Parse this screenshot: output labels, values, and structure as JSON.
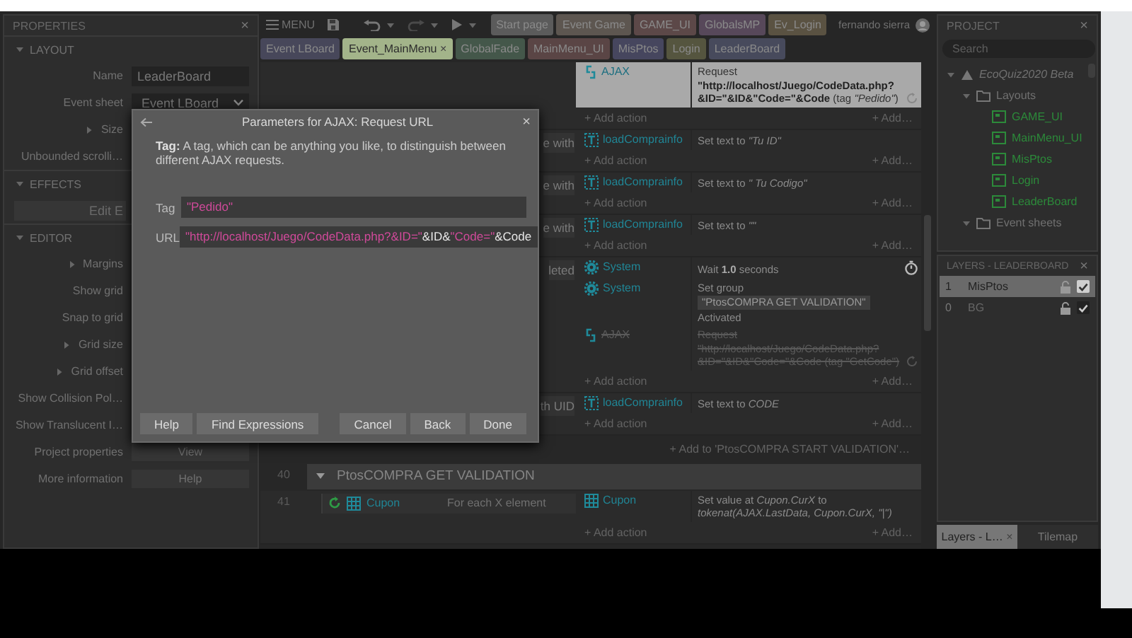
{
  "top_bar": {
    "menu_label": "MENU",
    "user_name": "fernando sierra"
  },
  "tab_rows": [
    {
      "tabs": [
        {
          "label": "Start page",
          "color": "#5b5b5b",
          "selected": false
        },
        {
          "label": "Event Game",
          "color": "#5d5650",
          "selected": false
        },
        {
          "label": "GAME_UI",
          "color": "#5c4848",
          "selected": false
        },
        {
          "label": "GlobalsMP",
          "color": "#57485a",
          "selected": false
        },
        {
          "label": "Ev_Login",
          "color": "#5a5242",
          "selected": false
        }
      ]
    },
    {
      "tabs": [
        {
          "label": "Event LBoard",
          "color": "#47475a",
          "selected": false
        },
        {
          "label": "Event_MainMenu",
          "color": "#a3b48a",
          "selected": true,
          "close": "×"
        },
        {
          "label": "GlobalFade",
          "color": "#44574a",
          "selected": false
        },
        {
          "label": "MainMenu_UI",
          "color": "#5a4545",
          "selected": false
        },
        {
          "label": "MisPtos",
          "color": "#46465e",
          "selected": false
        },
        {
          "label": "Login",
          "color": "#55553f",
          "selected": false
        },
        {
          "label": "LeaderBoard",
          "color": "#474a5c",
          "selected": false
        }
      ]
    }
  ],
  "properties": {
    "title": "PROPERTIES",
    "close": "×",
    "sections": [
      {
        "title": "LAYOUT",
        "expanded": true,
        "rows": [
          {
            "kind": "field",
            "label": "Name",
            "value": "LeaderBoard"
          },
          {
            "kind": "dropdown",
            "label": "Event sheet",
            "value": "Event LBoard"
          },
          {
            "kind": "group",
            "label": "Size"
          },
          {
            "kind": "label",
            "label": "Unbounded scrolli…"
          }
        ]
      },
      {
        "title": "EFFECTS",
        "expanded": true,
        "rows": [
          {
            "kind": "wide_button",
            "value": "Edit E"
          }
        ]
      },
      {
        "title": "EDITOR",
        "expanded": true,
        "rows": [
          {
            "kind": "group",
            "label": "Margins"
          },
          {
            "kind": "label",
            "label": "Show grid"
          },
          {
            "kind": "label",
            "label": "Snap to grid"
          },
          {
            "kind": "group",
            "label": "Grid size"
          },
          {
            "kind": "group",
            "label": "Grid offset"
          },
          {
            "kind": "label",
            "label": "Show Collision Pol…"
          },
          {
            "kind": "label",
            "label": "Show Translucent I…"
          },
          {
            "kind": "button",
            "label": "Project properties",
            "value": "View"
          },
          {
            "kind": "button",
            "label": "More information",
            "value": "Help"
          }
        ]
      }
    ]
  },
  "event_sheet": {
    "blocks": [
      {
        "kind": "event",
        "actions": [
          {
            "object": "AJAX",
            "kind": "ajax",
            "text": "Request **\"http://localhost/Juego/CodeData.php?&ID=\"&ID&\"Code=\"&Code** (tag *\"Pedido\"*)",
            "selected": true,
            "disabled": false,
            "async": true
          }
        ],
        "add_action": "+ Add action",
        "add_more": "+ Add…"
      },
      {
        "kind": "event",
        "condition": {
          "text": "e with"
        },
        "actions": [
          {
            "object": "loadComprainfo",
            "kind": "text",
            "text": "Set text to *\"Tu ID\"*",
            "selected": false,
            "disabled": false
          }
        ],
        "add_action": "+ Add action",
        "add_more": "+ Add…"
      },
      {
        "kind": "event",
        "condition": {
          "text": "e with"
        },
        "actions": [
          {
            "object": "loadComprainfo",
            "kind": "text",
            "text": "Set text to *\" Tu Codigo\"*",
            "selected": false,
            "disabled": false
          }
        ],
        "add_action": "+ Add action",
        "add_more": "+ Add…"
      },
      {
        "kind": "event",
        "condition": {
          "text": "e with"
        },
        "actions": [
          {
            "object": "loadComprainfo",
            "kind": "text",
            "text": "Set text to *\"\"*",
            "selected": false,
            "disabled": false
          }
        ],
        "add_action": "+ Add action",
        "add_more": "+ Add…"
      },
      {
        "kind": "event",
        "condition": {
          "text": "leted"
        },
        "actions": [
          {
            "object": "System",
            "kind": "system",
            "text": "Wait **1.0** seconds",
            "selected": false,
            "disabled": false,
            "async": true
          },
          {
            "object": "System",
            "kind": "system",
            "before": "Set group",
            "badge": "\"PtosCOMPRA GET VALIDATION\"",
            "after": "Activated",
            "selected": false,
            "disabled": false
          },
          {
            "object": "AJAX",
            "kind": "ajax",
            "text": "Request \"http://localhost/Juego/CodeData.php?&ID=\"&ID&\"Code=\"&Code (tag \"GetCode\")",
            "selected": false,
            "disabled": true,
            "async": true
          }
        ],
        "add_action": "+ Add action",
        "add_more": "+ Add…"
      },
      {
        "kind": "event",
        "condition": {
          "text": "th UID"
        },
        "actions": [
          {
            "object": "loadComprainfo",
            "kind": "text",
            "text": "Set text to *CODE*",
            "selected": false,
            "disabled": false
          }
        ],
        "add_action": "+ Add action",
        "add_more": "+ Add…"
      },
      {
        "kind": "add_to",
        "text": "+ Add to 'PtosCOMPRA START VALIDATION'…"
      },
      {
        "kind": "group",
        "number": "40",
        "title": "PtosCOMPRA GET VALIDATION",
        "expanded": true
      },
      {
        "kind": "event",
        "number": "41",
        "condition": {
          "object": "Cupon",
          "kind": "array",
          "loop": true,
          "text": "For each X element"
        },
        "actions": [
          {
            "object": "Cupon",
            "kind": "array",
            "text": "Set value at *Cupon.CurX* to *tokenat(AJAX.LastData, Cupon.CurX, \"|\")*",
            "selected": false,
            "disabled": false
          }
        ],
        "add_action": "+ Add action",
        "add_more": "+ Add…"
      }
    ]
  },
  "dialog": {
    "title": "Parameters for AJAX: Request URL",
    "close": "×",
    "description": "**Tag:** A tag, which can be anything you like, to distinguish between different AJAX requests.",
    "params": [
      {
        "label": "Tag",
        "segments": [
          {
            "kind": "string",
            "text": "\"Pedido\""
          }
        ]
      },
      {
        "label": "URL",
        "segments": [
          {
            "kind": "string",
            "text": "\"http://localhost/Juego/CodeData.php?&ID=\""
          },
          {
            "kind": "expr",
            "text": "&ID&"
          },
          {
            "kind": "string",
            "text": "\"Code=\""
          },
          {
            "kind": "expr",
            "text": "&Code"
          }
        ]
      }
    ],
    "buttons_left": [
      "Help",
      "Find Expressions"
    ],
    "buttons_right": [
      "Cancel",
      "Back",
      "Done"
    ]
  },
  "project": {
    "title": "PROJECT",
    "close": "×",
    "search": {
      "placeholder": "Search"
    },
    "tree": [
      {
        "label": "EcoQuiz2020 Beta",
        "kind": "project",
        "expanded": true,
        "children": [
          {
            "label": "Layouts",
            "kind": "folder",
            "expanded": true,
            "children": [
              {
                "label": "GAME_UI",
                "kind": "layout"
              },
              {
                "label": "MainMenu_UI",
                "kind": "layout"
              },
              {
                "label": "MisPtos",
                "kind": "layout"
              },
              {
                "label": "Login",
                "kind": "layout"
              },
              {
                "label": "LeaderBoard",
                "kind": "layout"
              }
            ]
          },
          {
            "label": "Event sheets",
            "kind": "folder",
            "expanded": true
          }
        ]
      }
    ]
  },
  "layers": {
    "title": "LAYERS - LEADERBOARD",
    "close": "×",
    "items": [
      {
        "number": "1",
        "name": "MisPtos",
        "selected": true,
        "visible": true
      },
      {
        "number": "0",
        "name": "BG",
        "selected": false,
        "visible": true
      }
    ]
  },
  "bottom_tabs": [
    {
      "label": "Layers - L…",
      "close": "×",
      "selected": true
    },
    {
      "label": "Tilemap",
      "selected": false
    }
  ]
}
